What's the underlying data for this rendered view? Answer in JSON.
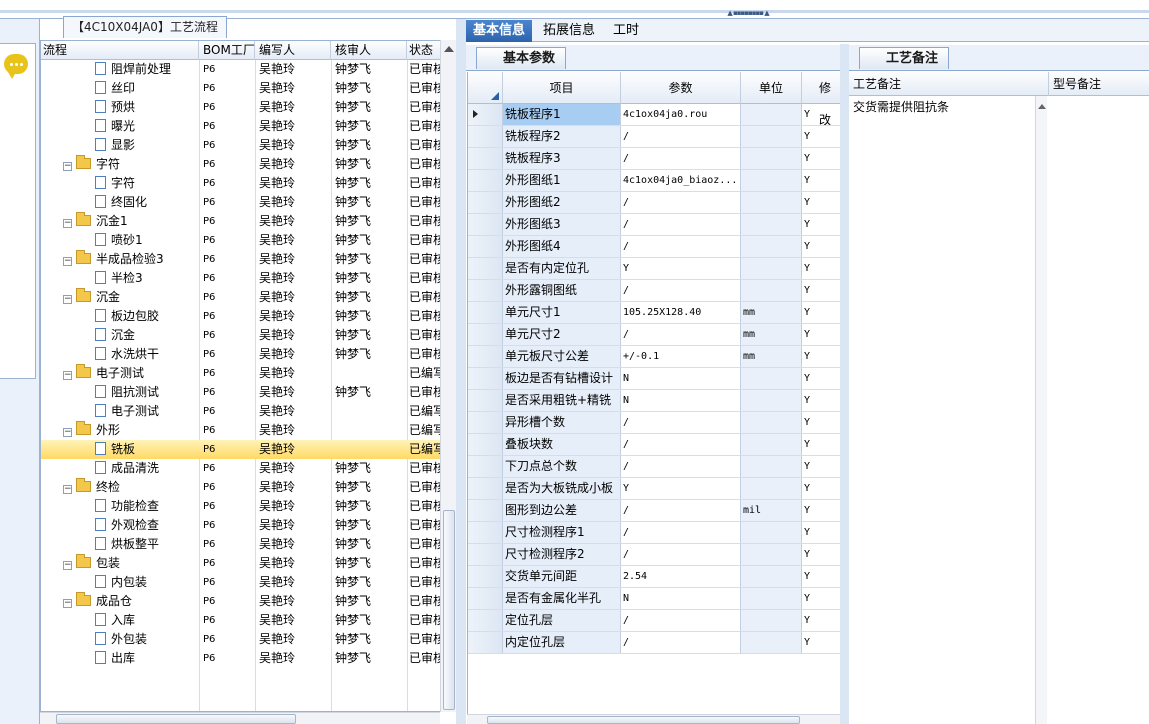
{
  "tree_tab": {
    "title": "【4C10X04JA0】工艺流程"
  },
  "tree": {
    "columns": [
      "流程",
      "BOM工厂",
      "编写人",
      "核审人",
      "状态"
    ],
    "rows": [
      {
        "name": "阻焊前处理",
        "level": 2,
        "type": "doc",
        "bom": "P6",
        "editor": "吴艳玲",
        "reviewer": "钟梦飞",
        "status": "已审核"
      },
      {
        "name": "丝印",
        "level": 2,
        "type": "doc",
        "bom": "P6",
        "editor": "吴艳玲",
        "reviewer": "钟梦飞",
        "status": "已审核"
      },
      {
        "name": "预烘",
        "level": 2,
        "type": "doc",
        "bom": "P6",
        "editor": "吴艳玲",
        "reviewer": "钟梦飞",
        "status": "已审核"
      },
      {
        "name": "曝光",
        "level": 2,
        "type": "doc",
        "bom": "P6",
        "editor": "吴艳玲",
        "reviewer": "钟梦飞",
        "status": "已审核"
      },
      {
        "name": "显影",
        "level": 2,
        "type": "doc",
        "bom": "P6",
        "editor": "吴艳玲",
        "reviewer": "钟梦飞",
        "status": "已审核"
      },
      {
        "name": "字符",
        "level": 1,
        "type": "folder",
        "bom": "P6",
        "editor": "吴艳玲",
        "reviewer": "钟梦飞",
        "status": "已审核"
      },
      {
        "name": "字符",
        "level": 2,
        "type": "doc",
        "bom": "P6",
        "editor": "吴艳玲",
        "reviewer": "钟梦飞",
        "status": "已审核"
      },
      {
        "name": "终固化",
        "level": 2,
        "type": "doc",
        "bom": "P6",
        "editor": "吴艳玲",
        "reviewer": "钟梦飞",
        "status": "已审核"
      },
      {
        "name": "沉金1",
        "level": 1,
        "type": "folder",
        "bom": "P6",
        "editor": "吴艳玲",
        "reviewer": "钟梦飞",
        "status": "已审核"
      },
      {
        "name": "喷砂1",
        "level": 2,
        "type": "doc",
        "bom": "P6",
        "editor": "吴艳玲",
        "reviewer": "钟梦飞",
        "status": "已审核"
      },
      {
        "name": "半成品检验3",
        "level": 1,
        "type": "folder",
        "bom": "P6",
        "editor": "吴艳玲",
        "reviewer": "钟梦飞",
        "status": "已审核"
      },
      {
        "name": "半检3",
        "level": 2,
        "type": "doc",
        "bom": "P6",
        "editor": "吴艳玲",
        "reviewer": "钟梦飞",
        "status": "已审核"
      },
      {
        "name": "沉金",
        "level": 1,
        "type": "folder",
        "bom": "P6",
        "editor": "吴艳玲",
        "reviewer": "钟梦飞",
        "status": "已审核"
      },
      {
        "name": "板边包胶",
        "level": 2,
        "type": "doc",
        "bom": "P6",
        "editor": "吴艳玲",
        "reviewer": "钟梦飞",
        "status": "已审核"
      },
      {
        "name": "沉金",
        "level": 2,
        "type": "doc",
        "bom": "P6",
        "editor": "吴艳玲",
        "reviewer": "钟梦飞",
        "status": "已审核"
      },
      {
        "name": "水洗烘干",
        "level": 2,
        "type": "doc",
        "bom": "P6",
        "editor": "吴艳玲",
        "reviewer": "钟梦飞",
        "status": "已审核"
      },
      {
        "name": "电子测试",
        "level": 1,
        "type": "folder",
        "bom": "P6",
        "editor": "吴艳玲",
        "reviewer": "",
        "status": "已编写"
      },
      {
        "name": "阻抗测试",
        "level": 2,
        "type": "doc",
        "bom": "P6",
        "editor": "吴艳玲",
        "reviewer": "钟梦飞",
        "status": "已审核"
      },
      {
        "name": "电子测试",
        "level": 2,
        "type": "doc",
        "bom": "P6",
        "editor": "吴艳玲",
        "reviewer": "",
        "status": "已编写"
      },
      {
        "name": "外形",
        "level": 1,
        "type": "folder",
        "bom": "P6",
        "editor": "吴艳玲",
        "reviewer": "",
        "status": "已编写"
      },
      {
        "name": "铣板",
        "level": 2,
        "type": "doc",
        "bom": "P6",
        "editor": "吴艳玲",
        "reviewer": "",
        "status": "已编写",
        "selected": true
      },
      {
        "name": "成品清洗",
        "level": 2,
        "type": "doc",
        "bom": "P6",
        "editor": "吴艳玲",
        "reviewer": "钟梦飞",
        "status": "已审核"
      },
      {
        "name": "终检",
        "level": 1,
        "type": "folder",
        "bom": "P6",
        "editor": "吴艳玲",
        "reviewer": "钟梦飞",
        "status": "已审核"
      },
      {
        "name": "功能检查",
        "level": 2,
        "type": "doc",
        "bom": "P6",
        "editor": "吴艳玲",
        "reviewer": "钟梦飞",
        "status": "已审核"
      },
      {
        "name": "外观检查",
        "level": 2,
        "type": "doc",
        "bom": "P6",
        "editor": "吴艳玲",
        "reviewer": "钟梦飞",
        "status": "已审核"
      },
      {
        "name": "烘板整平",
        "level": 2,
        "type": "doc",
        "bom": "P6",
        "editor": "吴艳玲",
        "reviewer": "钟梦飞",
        "status": "已审核"
      },
      {
        "name": "包装",
        "level": 1,
        "type": "folder",
        "bom": "P6",
        "editor": "吴艳玲",
        "reviewer": "钟梦飞",
        "status": "已审核"
      },
      {
        "name": "内包装",
        "level": 2,
        "type": "doc",
        "bom": "P6",
        "editor": "吴艳玲",
        "reviewer": "钟梦飞",
        "status": "已审核"
      },
      {
        "name": "成品仓",
        "level": 1,
        "type": "folder",
        "bom": "P6",
        "editor": "吴艳玲",
        "reviewer": "钟梦飞",
        "status": "已审核"
      },
      {
        "name": "入库",
        "level": 2,
        "type": "doc",
        "bom": "P6",
        "editor": "吴艳玲",
        "reviewer": "钟梦飞",
        "status": "已审核"
      },
      {
        "name": "外包装",
        "level": 2,
        "type": "doc",
        "bom": "P6",
        "editor": "吴艳玲",
        "reviewer": "钟梦飞",
        "status": "已审核"
      },
      {
        "name": "出库",
        "level": 2,
        "type": "doc",
        "bom": "P6",
        "editor": "吴艳玲",
        "reviewer": "钟梦飞",
        "status": "已审核"
      }
    ]
  },
  "main_tabs": [
    "基本信息",
    "拓展信息",
    "工时"
  ],
  "params_tab": {
    "title": "基本参数"
  },
  "params": {
    "columns": [
      "项目",
      "参数",
      "单位",
      "修改"
    ],
    "rows": [
      {
        "item": "铣板程序1",
        "value": "4c1ox04ja0.rou",
        "unit": "",
        "mod": "Y",
        "current": true
      },
      {
        "item": "铣板程序2",
        "value": "/",
        "unit": "",
        "mod": "Y"
      },
      {
        "item": "铣板程序3",
        "value": "/",
        "unit": "",
        "mod": "Y"
      },
      {
        "item": "外形图纸1",
        "value": "4c1ox04ja0_biaoz...",
        "unit": "",
        "mod": "Y"
      },
      {
        "item": "外形图纸2",
        "value": "/",
        "unit": "",
        "mod": "Y"
      },
      {
        "item": "外形图纸3",
        "value": "/",
        "unit": "",
        "mod": "Y"
      },
      {
        "item": "外形图纸4",
        "value": "/",
        "unit": "",
        "mod": "Y"
      },
      {
        "item": "是否有内定位孔",
        "value": "Y",
        "unit": "",
        "mod": "Y"
      },
      {
        "item": "外形露铜图纸",
        "value": "/",
        "unit": "",
        "mod": "Y"
      },
      {
        "item": "单元尺寸1",
        "value": "105.25X128.40",
        "unit": "mm",
        "mod": "Y"
      },
      {
        "item": "单元尺寸2",
        "value": "/",
        "unit": "mm",
        "mod": "Y"
      },
      {
        "item": "单元板尺寸公差",
        "value": "+/-0.1",
        "unit": "mm",
        "mod": "Y"
      },
      {
        "item": "板边是否有钻槽设计",
        "value": "N",
        "unit": "",
        "mod": "Y"
      },
      {
        "item": "是否采用粗铣+精铣",
        "value": "N",
        "unit": "",
        "mod": "Y"
      },
      {
        "item": "异形槽个数",
        "value": "/",
        "unit": "",
        "mod": "Y"
      },
      {
        "item": "叠板块数",
        "value": "/",
        "unit": "",
        "mod": "Y"
      },
      {
        "item": "下刀点总个数",
        "value": "/",
        "unit": "",
        "mod": "Y"
      },
      {
        "item": "是否为大板铣成小板",
        "value": "Y",
        "unit": "",
        "mod": "Y"
      },
      {
        "item": "图形到边公差",
        "value": "/",
        "unit": "mil",
        "mod": "Y"
      },
      {
        "item": "尺寸检测程序1",
        "value": "/",
        "unit": "",
        "mod": "Y"
      },
      {
        "item": "尺寸检测程序2",
        "value": "/",
        "unit": "",
        "mod": "Y"
      },
      {
        "item": "交货单元间距",
        "value": "2.54",
        "unit": "",
        "mod": "Y"
      },
      {
        "item": "是否有金属化半孔",
        "value": "N",
        "unit": "",
        "mod": "Y"
      },
      {
        "item": "定位孔层",
        "value": "/",
        "unit": "",
        "mod": "Y"
      },
      {
        "item": "内定位孔层",
        "value": "/",
        "unit": "",
        "mod": "Y"
      }
    ]
  },
  "remarks_tab": {
    "title": "工艺备注"
  },
  "remarks": {
    "process_header": "工艺备注",
    "model_header": "型号备注",
    "process_text": "交货需提供阻抗条",
    "model_text": ""
  }
}
